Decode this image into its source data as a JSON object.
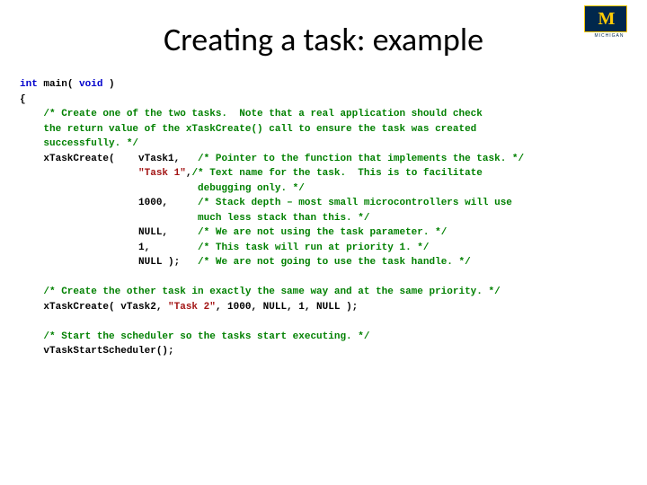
{
  "logo": {
    "letter": "M",
    "label": "MICHIGAN"
  },
  "title": "Creating a task: example",
  "code": {
    "l1_kw1": "int",
    "l1_fn": " main( ",
    "l1_kw2": "void",
    "l1_end": " )",
    "l2": "{",
    "c1a": "    /* Create one of the two tasks.  Note that a real application should check",
    "c1b": "    the return value of the xTaskCreate() call to ensure the task was created",
    "c1c": "    successfully. */",
    "l3a": "    xTaskCreate(    vTask1,   ",
    "l3a_c": "/* Pointer to the function that implements the task. */",
    "l3b_pre": "                    ",
    "l3b_str": "\"Task 1\"",
    "l3b_post": ",",
    "l3b_c": "/* Text name for the task.  This is to facilitate",
    "l3b_c2": "                              debugging only. */",
    "l3c": "                    1000,     ",
    "l3c_c": "/* Stack depth – most small microcontrollers will use",
    "l3c_c2": "                              much less stack than this. */",
    "l3d": "                    NULL,     ",
    "l3d_c": "/* We are not using the task parameter. */",
    "l3e": "                    1,        ",
    "l3e_c": "/* This task will run at priority 1. */",
    "l3f": "                    NULL );   ",
    "l3f_c": "/* We are not going to use the task handle. */",
    "c2": "    /* Create the other task in exactly the same way and at the same priority. */",
    "l4a": "    xTaskCreate( vTask2, ",
    "l4str": "\"Task 2\"",
    "l4b": ", 1000, NULL, 1, NULL );",
    "c3": "    /* Start the scheduler so the tasks start executing. */",
    "l5": "    vTaskStartScheduler();"
  }
}
